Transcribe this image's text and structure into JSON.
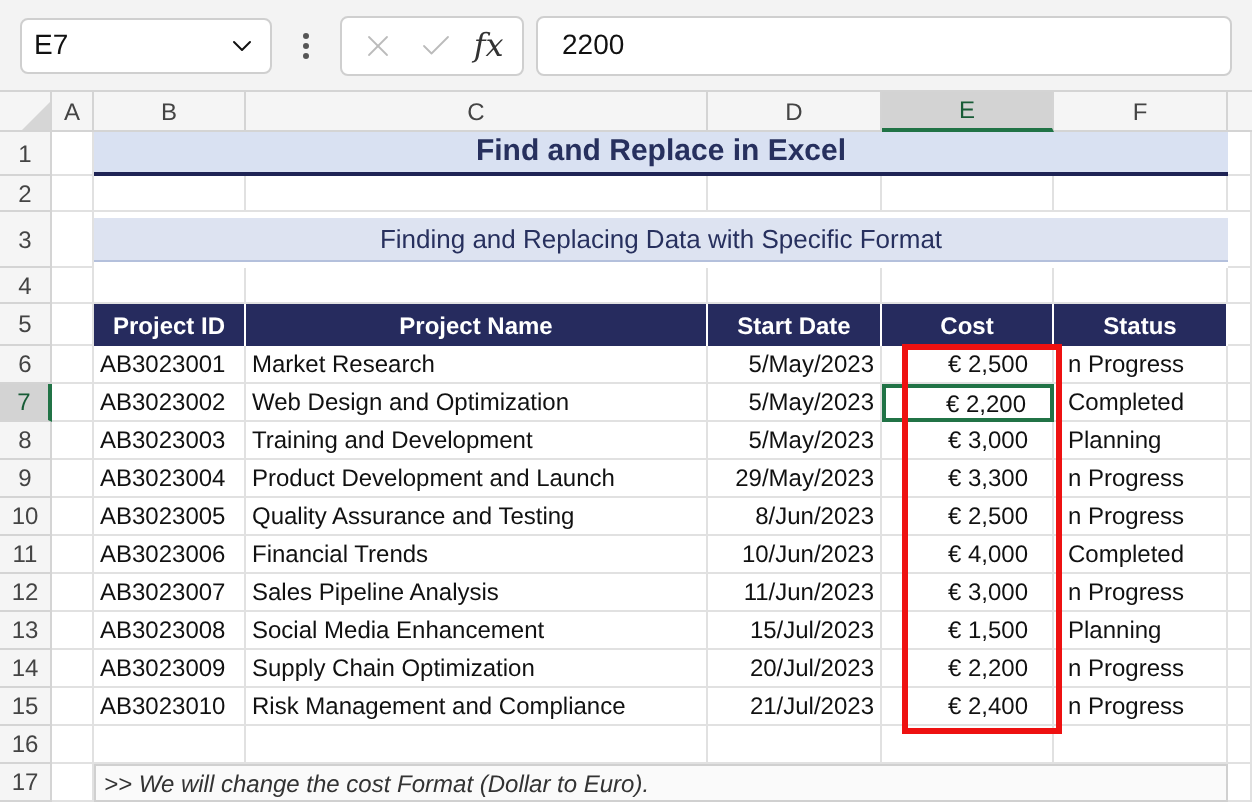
{
  "formula_bar": {
    "name_box": "E7",
    "function_label": "fx",
    "value": "2200"
  },
  "columns": [
    {
      "label": "A",
      "selected": false
    },
    {
      "label": "B",
      "selected": false
    },
    {
      "label": "C",
      "selected": false
    },
    {
      "label": "D",
      "selected": false
    },
    {
      "label": "E",
      "selected": true
    },
    {
      "label": "F",
      "selected": false
    }
  ],
  "row_numbers": [
    {
      "label": "1",
      "selected": false
    },
    {
      "label": "2",
      "selected": false
    },
    {
      "label": "3",
      "selected": false
    },
    {
      "label": "4",
      "selected": false
    },
    {
      "label": "5",
      "selected": false
    },
    {
      "label": "6",
      "selected": false
    },
    {
      "label": "7",
      "selected": true
    },
    {
      "label": "8",
      "selected": false
    },
    {
      "label": "9",
      "selected": false
    },
    {
      "label": "10",
      "selected": false
    },
    {
      "label": "11",
      "selected": false
    },
    {
      "label": "12",
      "selected": false
    },
    {
      "label": "13",
      "selected": false
    },
    {
      "label": "14",
      "selected": false
    },
    {
      "label": "15",
      "selected": false
    },
    {
      "label": "16",
      "selected": false
    },
    {
      "label": "17",
      "selected": false
    }
  ],
  "title": "Find and Replace in Excel",
  "subtitle": "Finding and Replacing Data with Specific Format",
  "table": {
    "highlight_cost_column": true,
    "columns": [
      "Project ID",
      "Project Name",
      "Start Date",
      "Cost",
      "Status"
    ],
    "rows": [
      {
        "id": "AB3023001",
        "name": "Market Research",
        "start_date": "5/May/2023",
        "cost": "€ 2,500",
        "status": "n Progress",
        "active": false
      },
      {
        "id": "AB3023002",
        "name": "Web Design and Optimization",
        "start_date": "5/May/2023",
        "cost": "€ 2,200",
        "status": "Completed",
        "active": true
      },
      {
        "id": "AB3023003",
        "name": "Training and Development",
        "start_date": "5/May/2023",
        "cost": "€ 3,000",
        "status": "Planning",
        "active": false
      },
      {
        "id": "AB3023004",
        "name": "Product Development and Launch",
        "start_date": "29/May/2023",
        "cost": "€ 3,300",
        "status": "n Progress",
        "active": false
      },
      {
        "id": "AB3023005",
        "name": "Quality Assurance and Testing",
        "start_date": "8/Jun/2023",
        "cost": "€ 2,500",
        "status": "n Progress",
        "active": false
      },
      {
        "id": "AB3023006",
        "name": "Financial Trends",
        "start_date": "10/Jun/2023",
        "cost": "€ 4,000",
        "status": "Completed",
        "active": false
      },
      {
        "id": "AB3023007",
        "name": "Sales Pipeline Analysis",
        "start_date": "11/Jun/2023",
        "cost": "€ 3,000",
        "status": "n Progress",
        "active": false
      },
      {
        "id": "AB3023008",
        "name": "Social Media Enhancement",
        "start_date": "15/Jul/2023",
        "cost": "€ 1,500",
        "status": "Planning",
        "active": false
      },
      {
        "id": "AB3023009",
        "name": "Supply Chain Optimization",
        "start_date": "20/Jul/2023",
        "cost": "€ 2,200",
        "status": "n Progress",
        "active": false
      },
      {
        "id": "AB3023010",
        "name": "Risk Management and Compliance",
        "start_date": "21/Jul/2023",
        "cost": "€ 2,400",
        "status": "n Progress",
        "active": false
      }
    ]
  },
  "note": ">> We will change the cost Format (Dollar to Euro)."
}
